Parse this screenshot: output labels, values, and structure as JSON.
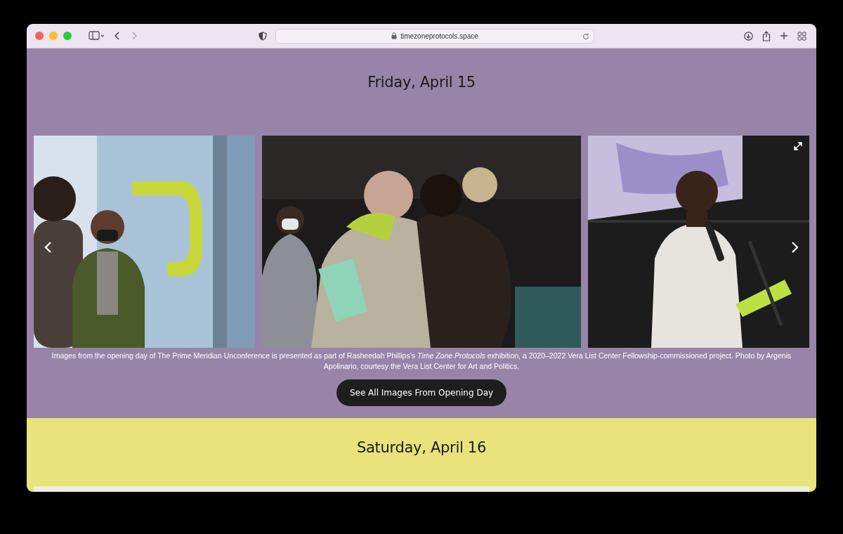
{
  "browser": {
    "url": "timezoneprotocols.space"
  },
  "days": [
    {
      "heading": "Friday, April 15",
      "caption": "Images from the opening day of The Prime Meridian Unconference is presented as part of Rasheedah Phillips’s *Time Zone Protocols* exhibition, a 2020–2022 Vera List Center Fellowship-commissioned project. Photo by Argenis Apolinario, courtesy the Vera List Center for Art and Politics.",
      "button": "See All Images From Opening Day"
    },
    {
      "heading": "Saturday, April 16"
    }
  ]
}
